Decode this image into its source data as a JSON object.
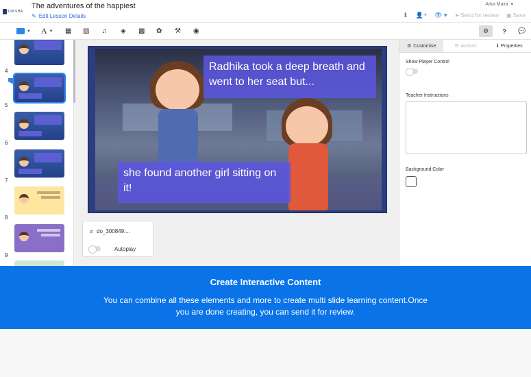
{
  "header": {
    "logo_text": "DIKSHA",
    "title": "The adventures of the happiest",
    "edit_link": "Edit Lesson Details",
    "user": "Arka Maini",
    "send_for_review": "Send for review",
    "save": "Save"
  },
  "thumbnails": [
    {
      "num": "4",
      "theme": "blue"
    },
    {
      "num": "5",
      "theme": "blue",
      "selected": true
    },
    {
      "num": "6",
      "theme": "blue"
    },
    {
      "num": "7",
      "theme": "blue"
    },
    {
      "num": "8",
      "theme": "yellow"
    },
    {
      "num": "9",
      "theme": "purple"
    }
  ],
  "slide": {
    "caption_top": "Radhika took a deep breath and went to her seat but...",
    "caption_bottom": "she found another girl sitting on it!"
  },
  "audio": {
    "name": "do_300849....",
    "autoplay_label": "Autoplay"
  },
  "panel": {
    "tabs": [
      "Customise",
      "Actions",
      "Properties"
    ],
    "show_player_control": "Show Player Control",
    "teacher_instructions": "Teacher Instructions",
    "background_color": "Background Color"
  },
  "banner": {
    "title": "Create Interactive Content",
    "text": "You can combine all these elements and more to create multi slide learning content.Once you are done creating, you can send it for review."
  },
  "colors": {
    "accent": "#0a73e8",
    "caption_bg": "#5c56e0"
  }
}
